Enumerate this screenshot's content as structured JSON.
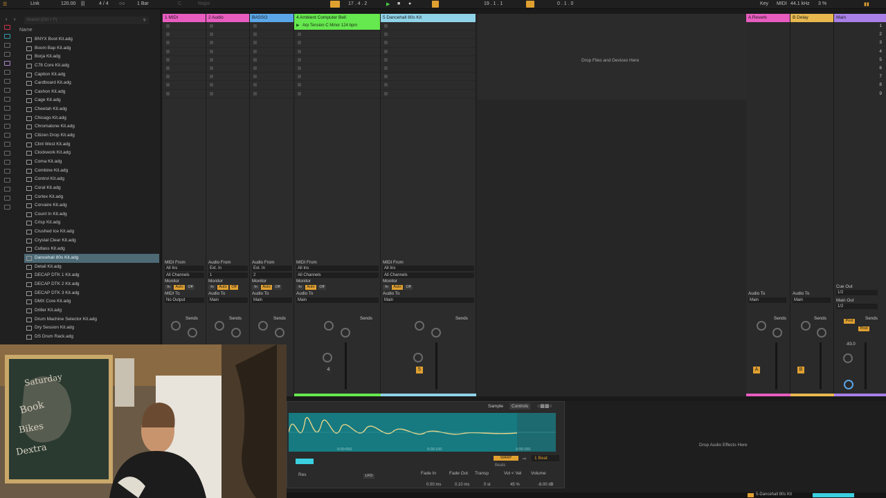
{
  "transport": {
    "menu_link": "Link",
    "tempo": "120.00",
    "time_sig": "4 / 4",
    "quantize": "1 Bar",
    "key": "C",
    "scale": "Major",
    "position": "17 . 4 . 2",
    "loop_position": "19 . 1 . 1",
    "loop_length": "0 . 1 . 0",
    "key_label": "Key",
    "midi_label": "MIDI",
    "sample_rate": "44.1 kHz",
    "cpu": "3 %"
  },
  "browser": {
    "search_placeholder": "Search (Ctrl + F)",
    "name_header": "Name",
    "items": [
      "BNYX Boot Kit.adg",
      "Boom Bap Kit.adg",
      "Borja Kit.adg",
      "C78 Core Kit.adg",
      "Caption Kit.adg",
      "Cardboard Kit.adg",
      "Cashon Kit.adg",
      "Cage Kit.adg",
      "Cheetah Kit.adg",
      "Chicago Kit.adg",
      "Chromatone Kit.adg",
      "Citizen Drop Kit.adg",
      "Clint West Kit.adg",
      "Clockwork Kit.adg",
      "Coma Kit.adg",
      "Combine Kit.adg",
      "Control Kit.adg",
      "Coral Kit.adg",
      "Cortex Kit.adg",
      "Corvaire Kit.adg",
      "Count In Kit.adg",
      "Crisp Kit.adg",
      "Crushed Ice Kit.adg",
      "Crystal Clear Kit.adg",
      "Cutlass Kit.adg",
      "Dancehall 80s Kit.adg",
      "Detail Kit.adg",
      "DECAP DTK 1 Kit.adg",
      "DECAP DTK 2 Kit.adg",
      "DECAP DTK 3 Kit.adg",
      "DMX Core Kit.adg",
      "Driller Kit.adg",
      "Drum Machine Selector Kit.adg",
      "Dry Session Kit.adg",
      "DS Drum Rack.adg"
    ],
    "selected_index": 25
  },
  "tracks": [
    {
      "name": "1 MIDI",
      "color": "#e85cbf",
      "from": "MIDI From",
      "from_val": "All Ins",
      "chan": "All Channels",
      "to_label": "MIDI To",
      "to_val": "No Output"
    },
    {
      "name": "2 Audio",
      "color": "#e85cbf",
      "from": "Audio From",
      "from_val": "Ext. In",
      "chan": "1",
      "to_label": "Audio To",
      "to_val": "Main"
    },
    {
      "name": "BASSO",
      "color": "#5aa6e8",
      "from": "Audio From",
      "from_val": "Ext. In",
      "chan": "2",
      "to_label": "Audio To",
      "to_val": "Main"
    },
    {
      "name": "4 Ambient Computer Bell",
      "color": "#66e84f",
      "from": "MIDI From",
      "from_val": "All Ins",
      "chan": "All Channels",
      "to_label": "Audio To",
      "to_val": "Main"
    },
    {
      "name": "5 Dancehall 80s Kit",
      "color": "#8fd3e8",
      "from": "MIDI From",
      "from_val": "All Ins",
      "chan": "All Channels",
      "to_label": "Audio To",
      "to_val": "Main"
    }
  ],
  "clip": {
    "name": "Arp Tension C Minor 124 bpm"
  },
  "monitor": {
    "label": "Monitor",
    "in": "In",
    "auto": "Auto",
    "off": "Off"
  },
  "sends_label": "Sends",
  "returns": [
    {
      "name": "A Reverb",
      "color": "#e85cbf",
      "letter": "A",
      "to_label": "Audio To",
      "to_val": "Main"
    },
    {
      "name": "B Delay",
      "color": "#e8b84f",
      "letter": "B",
      "to_label": "Audio To",
      "to_val": "Main"
    }
  ],
  "main": {
    "name": "Main",
    "color": "#a880e8",
    "cue_label": "Cue Out",
    "cue_val": "1/2",
    "main_label": "Main Out",
    "main_val": "1/2",
    "vol": "-83.0",
    "pre": "Post",
    "post": "Post"
  },
  "scenes": [
    "1",
    "2",
    "3",
    "4",
    "5",
    "6",
    "7",
    "8",
    "9"
  ],
  "track_numbers": {
    "t4": "4",
    "t5": "5"
  },
  "drop_files": "Drop Files and Devices Here",
  "drop_effects": "Drop Audio Effects Here",
  "sampler": {
    "tab_sample": "Sample",
    "tab_controls": "Controls",
    "time_left": "0:00:050",
    "time_mid": "0:00:100",
    "time_right": "0:00:150",
    "warp": "WARP",
    "beats_label": "Beats",
    "beat_val": "1 Beat",
    "lfo": "LFO",
    "fade_in_label": "Fade In",
    "fade_out_label": "Fade Out",
    "transp_label": "Transp",
    "vol_vel_label": "Vol < Vel",
    "volume_label": "Volume",
    "fade_in": "0.00 ms",
    "fade_out": "0.10 ms",
    "transp": "0 st",
    "vol_vel": "45 %",
    "volume": "-8.00 dB",
    "res_label": "Res"
  },
  "statusbar": {
    "track": "5-Dancehall 80s Kit"
  }
}
